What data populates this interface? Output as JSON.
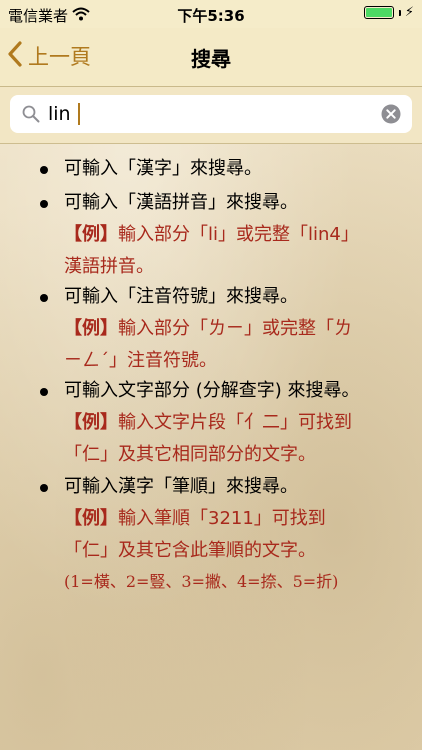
{
  "status_bar": {
    "carrier": "電信業者",
    "time": "下午5:36",
    "charging_symbol": "⚡",
    "battery_level": 1.0
  },
  "nav": {
    "back_label": "上一頁",
    "title": "搜尋"
  },
  "search": {
    "value": "lin",
    "placeholder": ""
  },
  "help": {
    "item1": "可輸入「漢字」來搜尋。",
    "item2": "可輸入「漢語拼音」來搜尋。",
    "item2_example_tag": "【例】",
    "item2_example_line1": "輸入部分「li」或完整「lin4」",
    "item2_example_line2": "漢語拼音。",
    "item3": "可輸入「注音符號」來搜尋。",
    "item3_example_tag": "【例】",
    "item3_example_line1": "輸入部分「ㄌㄧ」或完整「ㄌ",
    "item3_example_line2": "ㄧㄥˊ」注音符號。",
    "item4": "可輸入文字部分 (分解查字) 來搜尋。",
    "item4_example_tag": "【例】",
    "item4_example_line1": "輸入文字片段「亻二」可找到",
    "item4_example_line2": "「仁」及其它相同部分的文字。",
    "item5": "可輸入漢字「筆順」來搜尋。",
    "item5_example_tag": "【例】",
    "item5_example_line1": "輸入筆順「3211」可找到",
    "item5_example_line2": "「仁」及其它含此筆順的文字。",
    "item5_example_line3": "(1=橫、2=豎、3=撇、4=捺、5=折)"
  },
  "colors": {
    "accent": "#b07a1e",
    "example_text": "#a8291c",
    "battery": "#4cd964"
  }
}
